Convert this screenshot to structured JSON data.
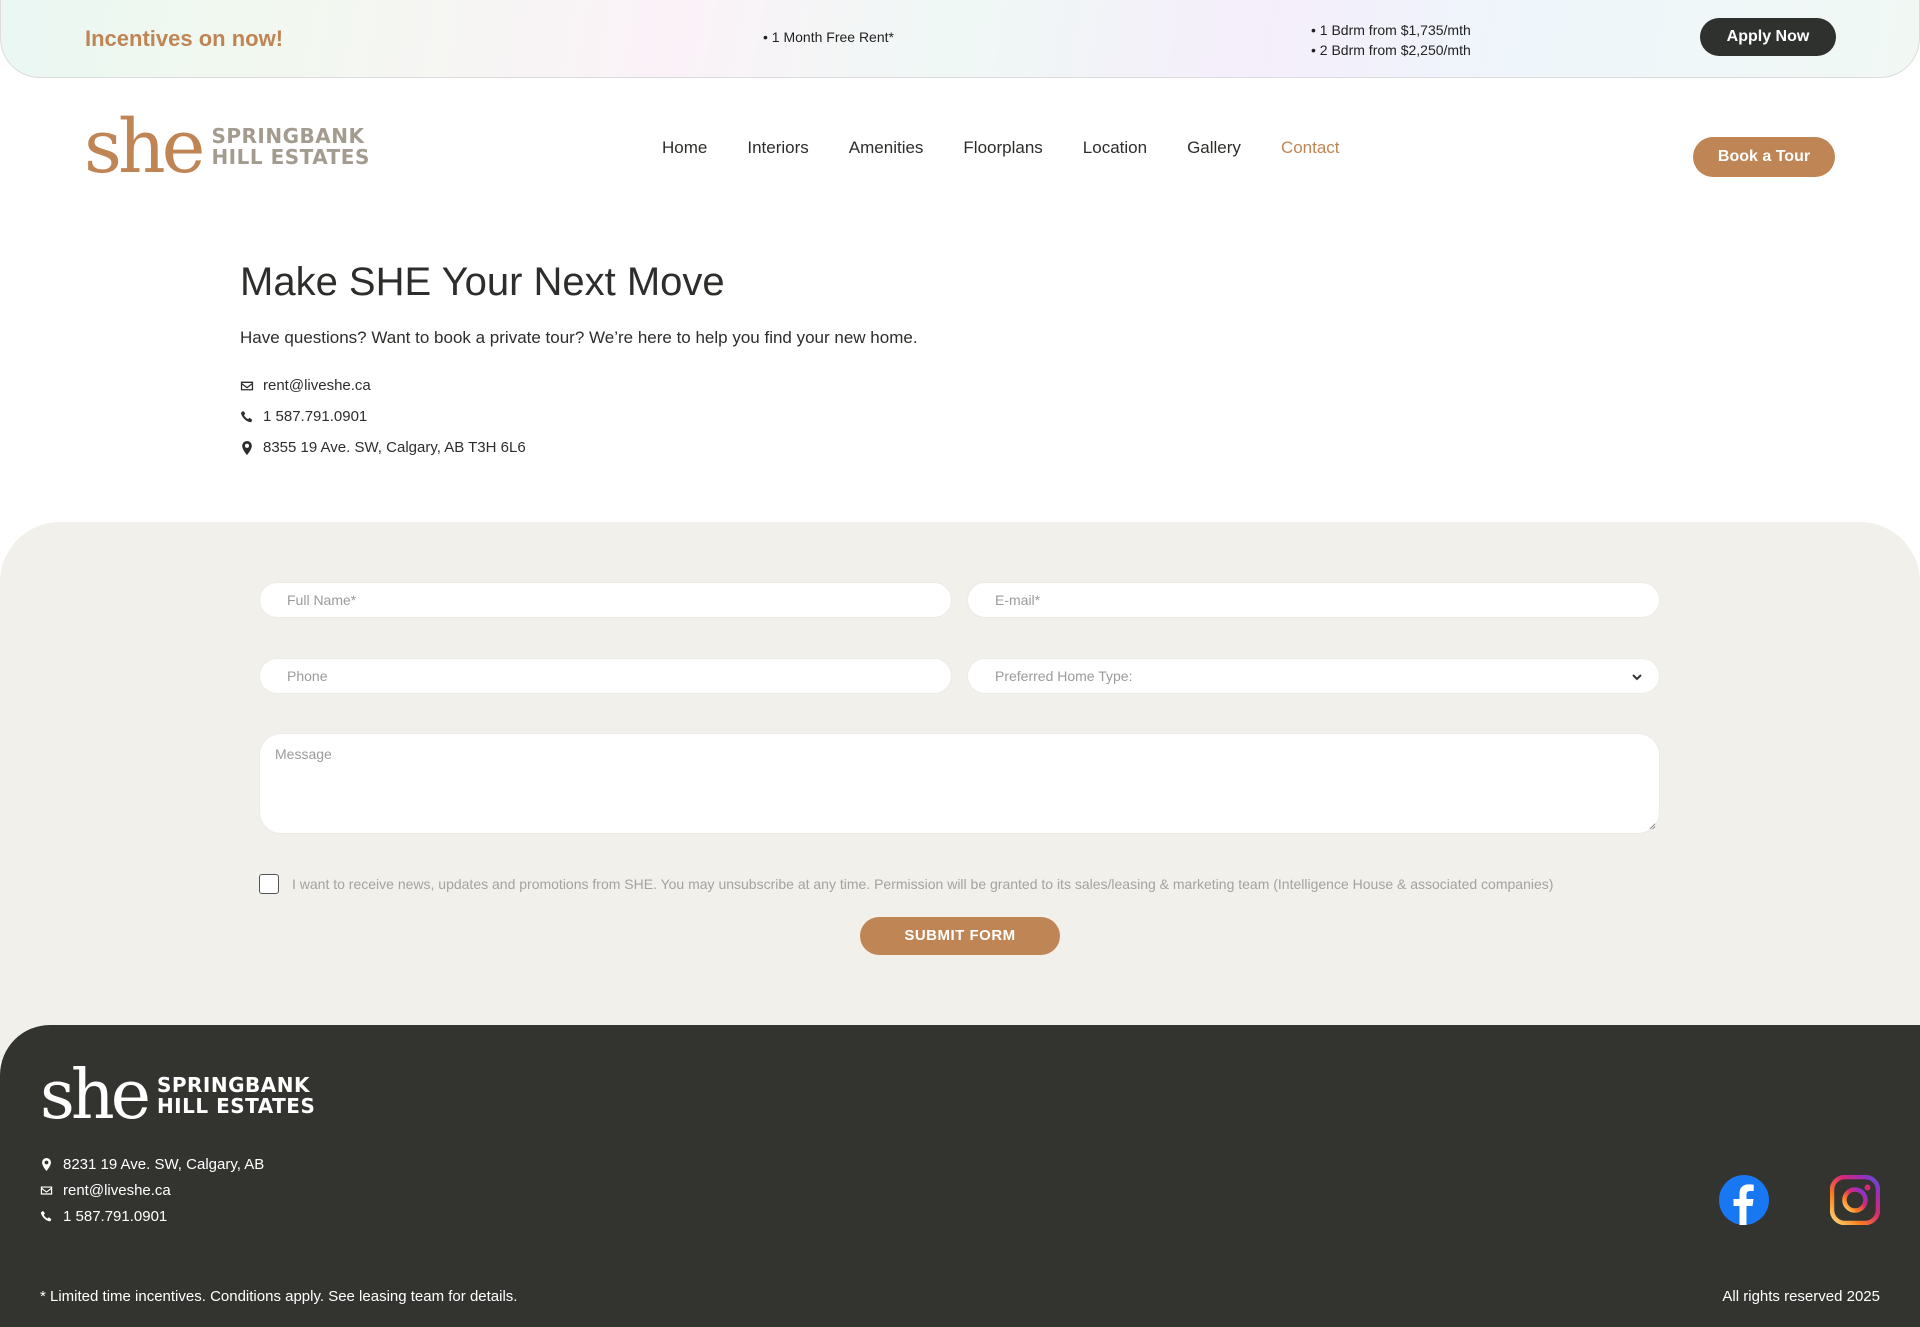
{
  "promo": {
    "headline": "Incentives on now!",
    "offer": "• 1 Month Free Rent*",
    "price_1": "• 1 Bdrm from $1,735/mth",
    "price_2": "• 2 Bdrm from $2,250/mth",
    "apply_label": "Apply Now"
  },
  "header": {
    "logo_mark": "she",
    "logo_line1": "SPRINGBANK",
    "logo_line2": "HILL ESTATES",
    "nav": [
      "Home",
      "Interiors",
      "Amenities",
      "Floorplans",
      "Location",
      "Gallery",
      "Contact"
    ],
    "active_nav": "Contact",
    "tour_label": "Book a Tour"
  },
  "intro": {
    "title": "Make SHE Your Next Move",
    "subtitle": "Have questions? Want to book a private tour? We’re here to help you find your new home.",
    "email": "rent@liveshe.ca",
    "phone": "1 587.791.0901",
    "address": "8355 19 Ave. SW, Calgary, AB T3H 6L6"
  },
  "form": {
    "name_placeholder": "Full Name*",
    "email_placeholder": "E-mail*",
    "phone_placeholder": "Phone",
    "type_placeholder": "Preferred Home Type:",
    "message_placeholder": "Message",
    "consent": "I want to receive news, updates and promotions from SHE. You may unsubscribe at any time. Permission will be granted to its sales/leasing & marketing team (Intelligence House & associated companies)",
    "submit_label": "SUBMIT FORM"
  },
  "footer": {
    "logo_mark": "she",
    "logo_line1": "SPRINGBANK",
    "logo_line2": "HILL ESTATES",
    "address": "8231 19 Ave. SW, Calgary, AB",
    "email": "rent@liveshe.ca",
    "phone": "1 587.791.0901",
    "disclaimer": "* Limited time incentives. Conditions apply. See leasing team for details.",
    "rights": "All rights reserved 2025"
  },
  "colors": {
    "accent": "#c08554",
    "dark": "#333430",
    "form_bg": "#f2f0eb"
  },
  "icons": [
    "envelope-icon",
    "phone-icon",
    "map-pin-icon",
    "chevron-down-icon",
    "facebook-icon",
    "instagram-icon"
  ]
}
